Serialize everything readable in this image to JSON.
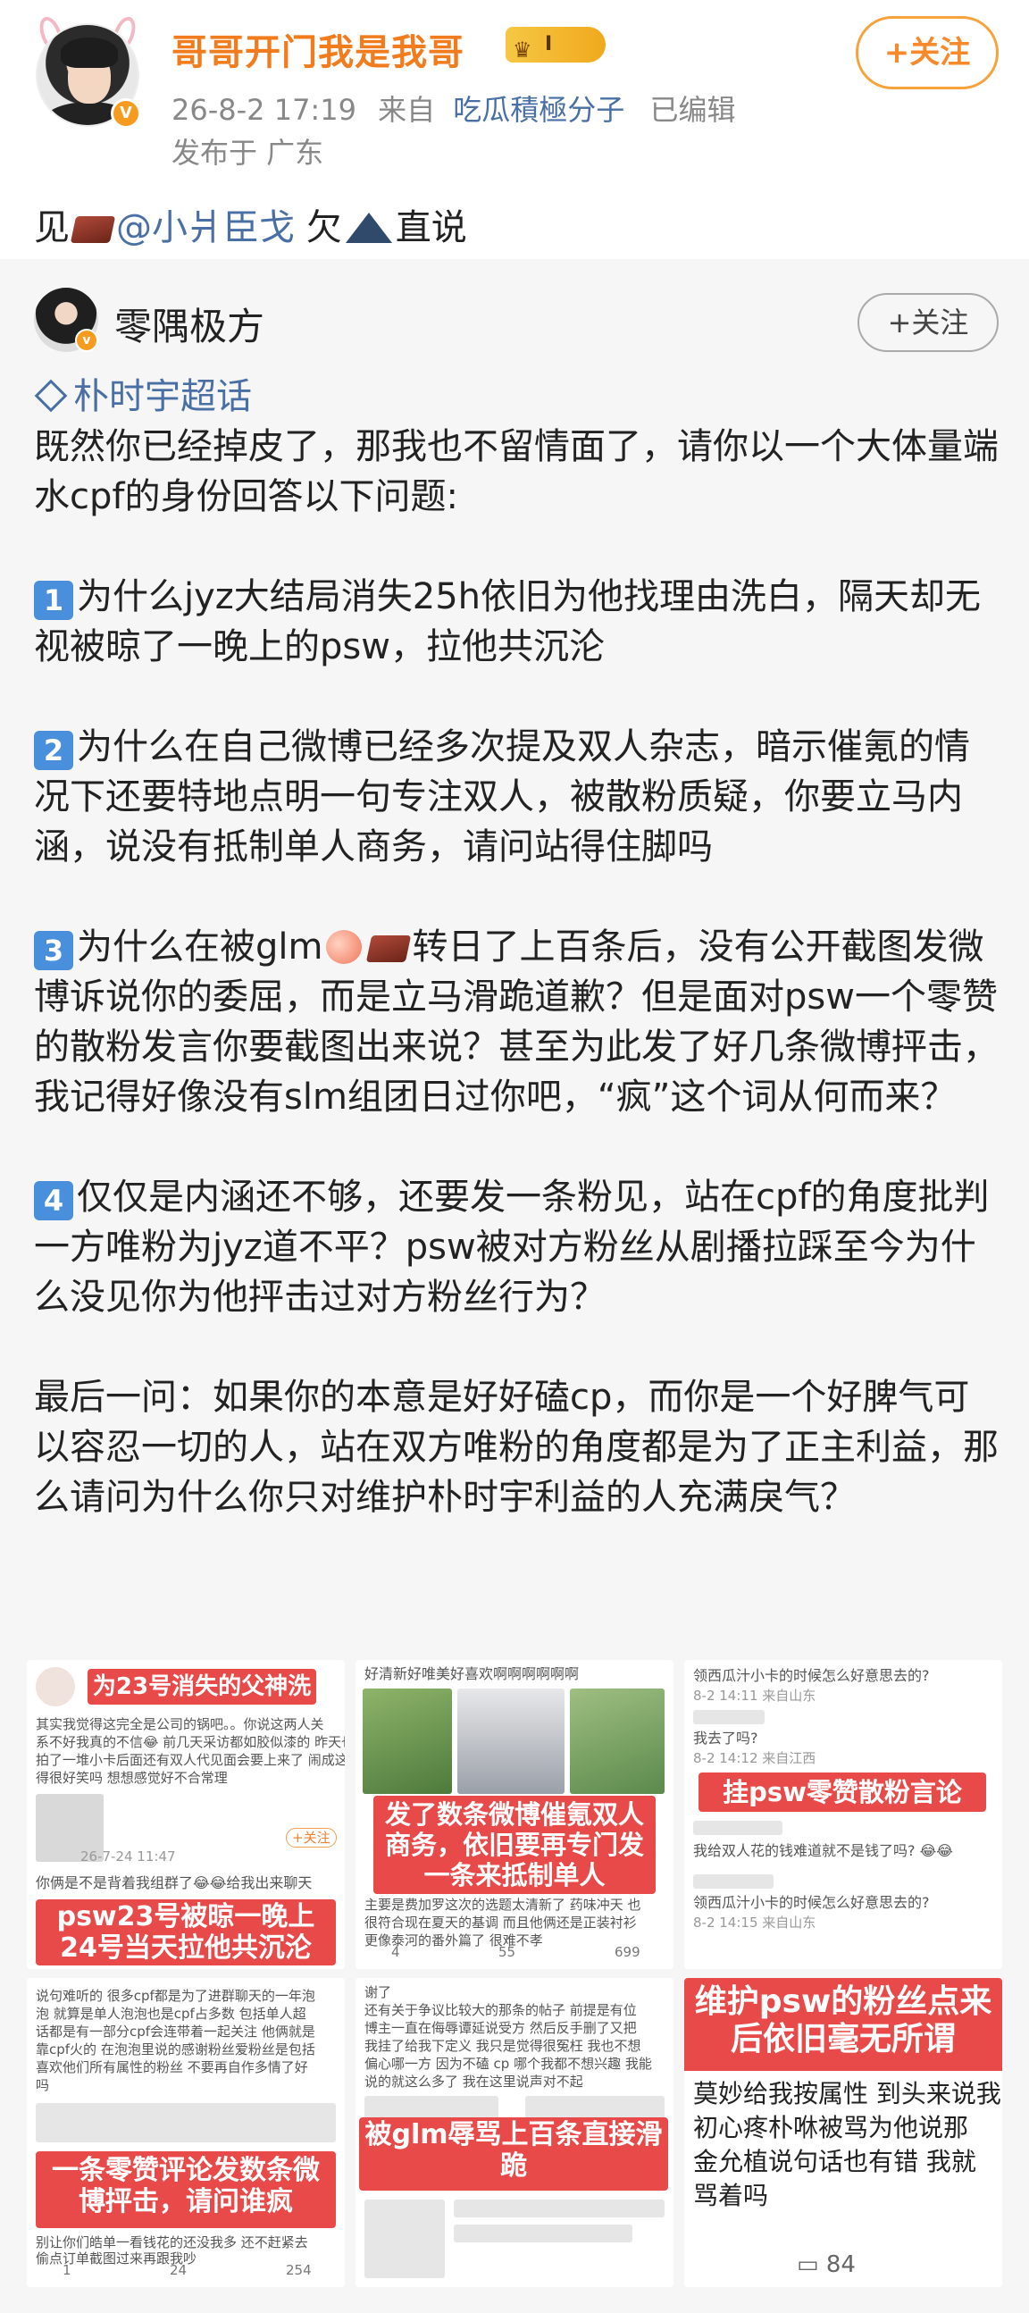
{
  "post": {
    "user_name": "哥哥开门我是我哥",
    "level_badge": "I",
    "date": "26-8-2 17:19",
    "from_label": "来自",
    "source": "吃瓜積極分子",
    "edited": "已编辑",
    "location": "发布于 广东",
    "follow_label": "+关注",
    "text_pre": "见",
    "mention": "@小爿臣戈",
    "text_mid": "欠",
    "text_post": "直说"
  },
  "quoted": {
    "user_name": "零隅极方",
    "follow_label": "+关注",
    "topic": "朴时宇超话",
    "intro": "既然你已经掉皮了，那我也不留情面了，请你以一个大体量端水cpf的身份回答以下问题:",
    "q1_num": "1",
    "q1": "为什么jyz大结局消失25h依旧为他找理由洗白，隔天却无视被晾了一晚上的psw，拉他共沉沦",
    "q2_num": "2",
    "q2": "为什么在自己微博已经多次提及双人杂志，暗示催氪的情况下还要特地点明一句专注双人，被散粉质疑，你要立马内涵，说没有抵制单人商务，请问站得住脚吗",
    "q3_num": "3",
    "q3_a": "为什么在被glm",
    "q3_b": "转日了上百条后，没有公开截图发微博诉说你的委屈，而是立马滑跪道歉？但是面对psw一个零赞的散粉发言你要截图出来说？甚至为此发了好几条微博抨击，我记得好像没有slm组团日过你吧，“疯”这个词从何而来？",
    "q4_num": "4",
    "q4": "仅仅是内涵还不够，还要发一条粉见，站在cpf的角度批判一方唯粉为jyz道不平？psw被对方粉丝从剧播拉踩至今为什么没见你为他抨击过对方粉丝行为？",
    "final": "最后一问：如果你的本意是好好磕cp，而你是一个好脾气可以容忍一切的人，站在双方唯粉的角度都是为了正主利益，那么请问为什么你只对维护朴时宇利益的人充满戾气？"
  },
  "images": {
    "t1": {
      "top_label": "为23号消失的父神洗",
      "line1": "其实我觉得这完全是公司的锅吧。。你说这两人关",
      "line2": "系不好我真的不信😂 前几天采访都如胶似漆的 昨天也",
      "line3": "拍了一堆小卡后面还有双人代见面会要上来了 闹成这样不觉",
      "line4": "得很好笑吗 想想感觉好不合常理",
      "date": "26-7-24 11:47",
      "follow": "+关注",
      "reply": "你俩是不是背着我组群了😂😂给我出来聊天",
      "bottom_label": "psw23号被晾一晚上24号当天拉他共沉沦"
    },
    "t2": {
      "caption": "好清新好唯美好喜欢啊啊啊啊啊啊",
      "label": "发了数条微博催氪双人商务，依旧要再专门发一条来抵制单人",
      "line1": "主要是费加罗这次的选题太清新了 药味冲天 也",
      "line2": "很符合现在夏天的基调 而且他俩还是正装衬衫",
      "line3": "更像泰河的番外篇了 很难不孝",
      "stat1": "4",
      "stat2": "55",
      "stat3": "699"
    },
    "t3": {
      "line1": "领西瓜汁小卡的时候怎么好意思去的?",
      "meta1": "8-2 14:11  来自山东",
      "line2": "我去了吗?",
      "meta2": "8-2 14:12  来自江西",
      "label": "挂psw零赞散粉言论",
      "line3": "我给双人花的钱难道就不是钱了吗? 😂😂",
      "line4": "领西瓜汁小卡的时候怎么好意思去的?",
      "meta3": "8-2 14:15  来自山东"
    },
    "t4": {
      "line1": "说句难听的 很多cpf都是为了进群聊天的一年泡",
      "line2": "泡 就算是单人泡泡也是cpf占多数 包括单人超",
      "line3": "话都是有一部分cpf会连带着一起关注 他俩就是",
      "line4": "靠cpf火的 在泡泡里说的感谢粉丝爱粉丝是包括",
      "line5": "喜欢他们所有属性的粉丝 不要再自作多情了好",
      "line6": "吗",
      "label": "一条零赞评论发数条微博抨击，请问谁疯",
      "reply": "别让你们皓单一看钱花的还没我多 还不赶紧去",
      "reply2": "偷点订单截图过来再跟我吵",
      "stat1": "1",
      "stat2": "24",
      "stat3": "254"
    },
    "t5": {
      "line1": "谢了",
      "line2": "还有关于争议比较大的那条的帖子 前提是有位",
      "line3": "博主一直在侮辱谭延说受方 然后反手删了又把",
      "line4": "我挂了给我下定义 我只是觉得很冤枉 我也不想",
      "line5": "偏心哪一方 因为不磕 cp 哪个我都不想兴趣 我能",
      "line6": "说的就这么多了 我在这里说声对不起",
      "label": "被glm辱骂上百条直接滑跪"
    },
    "t6": {
      "label": "维护psw的粉丝点来后依旧毫无所谓",
      "line1": "莫妙给我按属性 到头来说我",
      "line2": "初心疼朴咻被骂为他说那",
      "line3": "金允植说句话也有错 我就",
      "line4": "骂着吗",
      "count": "84"
    }
  }
}
